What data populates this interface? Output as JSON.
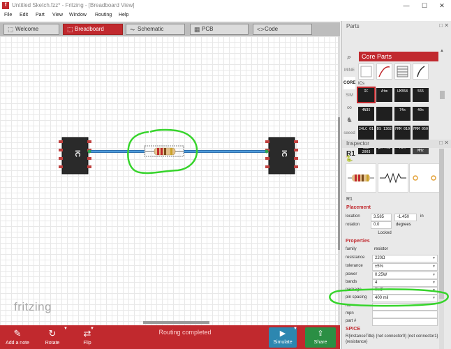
{
  "window": {
    "title": "Untitled Sketch.fzz* - Fritzing - [Breadboard View]",
    "app_icon": "f",
    "min_symbol": "—",
    "max_symbol": "☐",
    "close_symbol": "✕"
  },
  "menu": [
    "File",
    "Edit",
    "Part",
    "View",
    "Window",
    "Routing",
    "Help"
  ],
  "tabs": [
    {
      "label": "Welcome",
      "icon": "welcome-icon",
      "glyph": "⬚",
      "active": false
    },
    {
      "label": "Breadboard",
      "icon": "breadboard-icon",
      "glyph": "⬚",
      "active": true
    },
    {
      "label": "Schematic",
      "icon": "schematic-icon",
      "glyph": "⏦",
      "active": false
    },
    {
      "label": "PCB",
      "icon": "pcb-icon",
      "glyph": "▦",
      "active": false
    },
    {
      "label": "Code",
      "icon": "code-icon",
      "glyph": "<>",
      "active": false
    }
  ],
  "canvas": {
    "watermark": "fritzing",
    "chip_label": "IC",
    "annotation_color": "#37d42c",
    "wire_color": "#3a8fd6"
  },
  "toolbar": {
    "add_note": "Add a note",
    "rotate": "Rotate",
    "flip": "Flip",
    "routing_status": "Routing completed",
    "simulate": "Simulate",
    "share": "Share",
    "add_note_glyph": "✎",
    "rotate_glyph": "↻",
    "flip_glyph": "⇄",
    "simulate_glyph": "▶",
    "share_glyph": "⇪",
    "caret": "▼"
  },
  "parts": {
    "panel_title": "Parts",
    "bin_title": "Core Parts",
    "bins": [
      "MINE",
      "CORE",
      "SIM",
      "∞",
      "♞",
      "seeed",
      "◐",
      "🐍"
    ],
    "section_label": "ICs",
    "chips": [
      [
        "IC",
        "Atm",
        "LM358",
        "555"
      ],
      [
        "4N35",
        "",
        "74x",
        "40x"
      ],
      [
        "24LC 01",
        "DS 1302",
        "FRM 010",
        "FRM 050"
      ],
      [
        "ULN 2003",
        "μM PRU",
        "M54",
        "MHz"
      ]
    ]
  },
  "inspector": {
    "panel_title": "Inspector",
    "title": "R1",
    "name": "R1",
    "placement": {
      "header": "Placement",
      "location_label": "location",
      "x": "3.585",
      "y": "-1.450",
      "unit": "in",
      "rotation_label": "rotation",
      "rotation": "0.0",
      "rotation_unit": "degrees",
      "locked": "Locked"
    },
    "properties_header": "Properties",
    "properties": [
      {
        "label": "family",
        "value": "resistor",
        "dropdown": false,
        "boxed": false
      },
      {
        "label": "resistance",
        "value": "220Ω",
        "dropdown": true,
        "boxed": true
      },
      {
        "label": "tolerance",
        "value": "±5%",
        "dropdown": true,
        "boxed": true
      },
      {
        "label": "power",
        "value": "0.25W",
        "dropdown": true,
        "boxed": true
      },
      {
        "label": "bands",
        "value": "4",
        "dropdown": true,
        "boxed": true
      },
      {
        "label": "package",
        "value": "THT",
        "dropdown": true,
        "boxed": true
      },
      {
        "label": "pin spacing",
        "value": "400 mil",
        "dropdown": true,
        "boxed": true
      },
      {
        "label": "mn",
        "value": "",
        "dropdown": false,
        "boxed": true
      },
      {
        "label": "mpn",
        "value": "",
        "dropdown": false,
        "boxed": true
      },
      {
        "label": "part #",
        "value": "",
        "dropdown": false,
        "boxed": true
      }
    ],
    "spice_header": "SPICE",
    "spice_text": "R{instanceTitle} {net connector0} {net connector1} {resistance}"
  }
}
